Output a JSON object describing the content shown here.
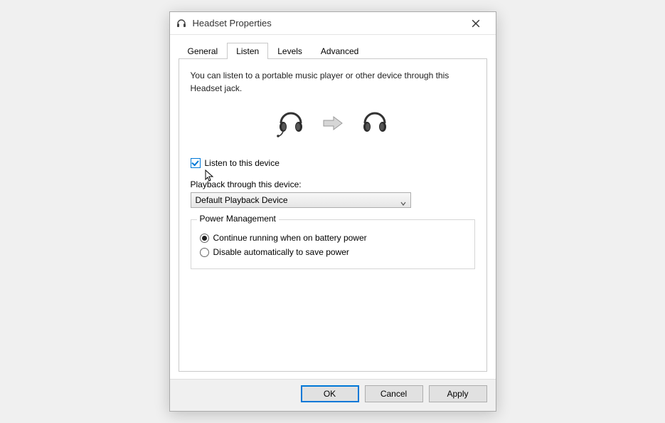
{
  "window": {
    "title": "Headset Properties"
  },
  "tabs": {
    "general": "General",
    "listen": "Listen",
    "levels": "Levels",
    "advanced": "Advanced",
    "active": "listen"
  },
  "listen_panel": {
    "description": "You can listen to a portable music player or other device through this Headset jack.",
    "listen_checkbox_label": "Listen to this device",
    "listen_checkbox_checked": true,
    "playback_label": "Playback through this device:",
    "playback_selected": "Default Playback Device",
    "power_group": {
      "legend": "Power Management",
      "option_continue": "Continue running when on battery power",
      "option_disable": "Disable automatically to save power",
      "selected": "continue"
    }
  },
  "buttons": {
    "ok": "OK",
    "cancel": "Cancel",
    "apply": "Apply"
  }
}
